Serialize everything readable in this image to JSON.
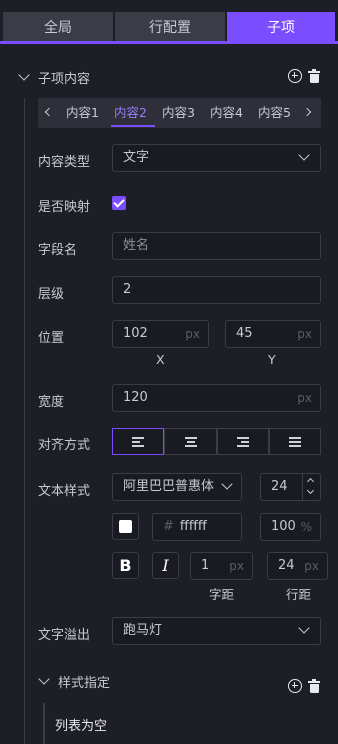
{
  "tabs": [
    {
      "label": "全局"
    },
    {
      "label": "行配置"
    },
    {
      "label": "子项"
    }
  ],
  "section": {
    "title": "子项内容"
  },
  "sub_tabs": [
    "内容1",
    "内容2",
    "内容3",
    "内容4",
    "内容5"
  ],
  "fields": {
    "content_type": {
      "label": "内容类型",
      "value": "文字"
    },
    "is_mapping": {
      "label": "是否映射",
      "checked": true
    },
    "field_name": {
      "label": "字段名",
      "placeholder": "姓名"
    },
    "layer": {
      "label": "层级",
      "value": "2"
    },
    "position": {
      "label": "位置",
      "x": "102",
      "y": "45",
      "unit": "px",
      "x_label": "X",
      "y_label": "Y"
    },
    "width": {
      "label": "宽度",
      "value": "120",
      "unit": "px"
    },
    "align": {
      "label": "对齐方式",
      "selected": "left"
    },
    "text_style": {
      "label": "文本样式",
      "font": "阿里巴巴普惠体",
      "size": "24",
      "color_hash": "#",
      "color": "ffffff",
      "opacity": "100",
      "opacity_unit": "%",
      "bold": "B",
      "italic": "I",
      "letter_spacing": "1",
      "line_height": "24",
      "unit": "px",
      "letter_spacing_label": "字距",
      "line_height_label": "行距"
    },
    "overflow": {
      "label": "文字溢出",
      "value": "跑马灯"
    }
  },
  "style_section": {
    "title": "样式指定",
    "empty_text": "列表为空"
  },
  "colors": {
    "accent": "#7a4dff",
    "background": "#1e1f26"
  },
  "icons": [
    "chevron-down-icon",
    "add-circle-icon",
    "trash-icon",
    "chevron-left-icon",
    "chevron-right-icon",
    "check-icon"
  ]
}
